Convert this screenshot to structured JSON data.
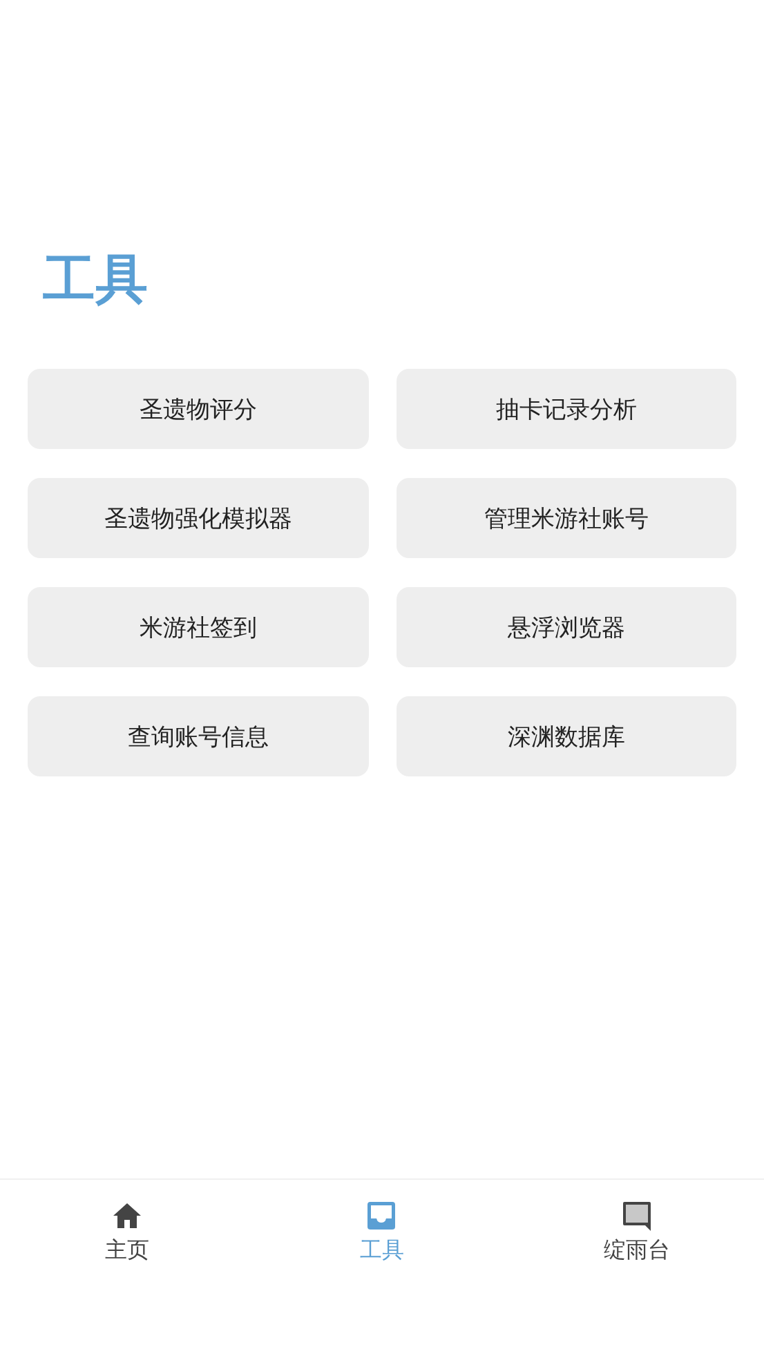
{
  "title": "工具",
  "tools": [
    "圣遗物评分",
    "抽卡记录分析",
    "圣遗物强化模拟器",
    "管理米游社账号",
    "米游社签到",
    "悬浮浏览器",
    "查询账号信息",
    "深渊数据库"
  ],
  "nav": [
    {
      "label": "主页",
      "selected": false
    },
    {
      "label": "工具",
      "selected": true
    },
    {
      "label": "绽雨台",
      "selected": false
    }
  ]
}
